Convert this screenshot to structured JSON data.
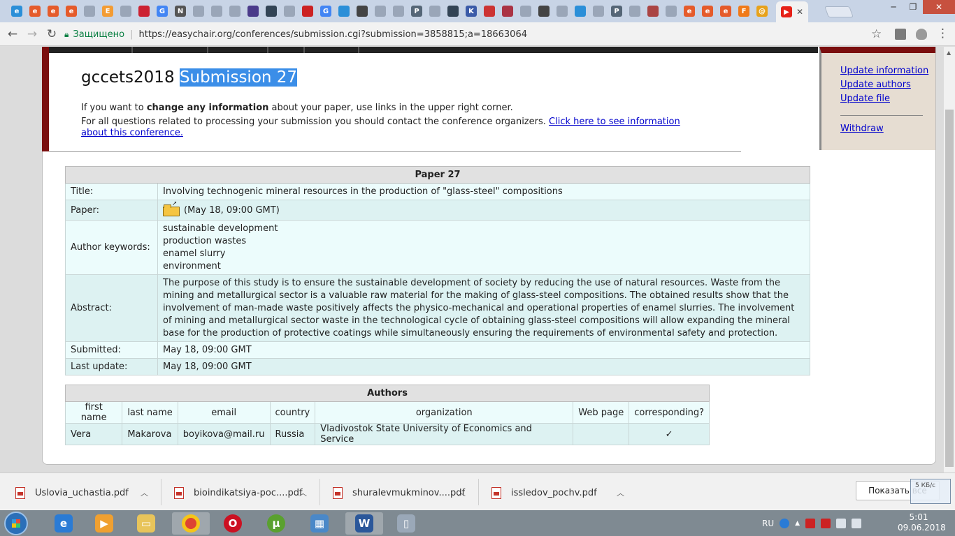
{
  "browser": {
    "tabs": [
      {
        "icon": "globe-icon",
        "color": "#2b8fd8",
        "glyph": "e"
      },
      {
        "icon": "e-orange-icon",
        "color": "#e55b2b",
        "glyph": "e"
      },
      {
        "icon": "e-orange-icon",
        "color": "#e55b2b",
        "glyph": "e"
      },
      {
        "icon": "e-orange-icon",
        "color": "#e55b2b",
        "glyph": "e"
      },
      {
        "icon": "doc-icon",
        "color": "#9aa6b8",
        "glyph": ""
      },
      {
        "icon": "e-box-icon",
        "color": "#f39c34",
        "glyph": "E"
      },
      {
        "icon": "doc-icon",
        "color": "#9aa6b8",
        "glyph": ""
      },
      {
        "icon": "news-icon",
        "color": "#cc2233",
        "glyph": ""
      },
      {
        "icon": "google-icon",
        "color": "#4285f4",
        "glyph": "G"
      },
      {
        "icon": "n-icon",
        "color": "#555555",
        "glyph": "N"
      },
      {
        "icon": "doc-icon",
        "color": "#9aa6b8",
        "glyph": ""
      },
      {
        "icon": "doc-icon",
        "color": "#9aa6b8",
        "glyph": ""
      },
      {
        "icon": "doc-icon",
        "color": "#9aa6b8",
        "glyph": ""
      },
      {
        "icon": "pattern-icon",
        "color": "#4a3a8a",
        "glyph": ""
      },
      {
        "icon": "swirl-icon",
        "color": "#334455",
        "glyph": ""
      },
      {
        "icon": "doc-icon",
        "color": "#9aa6b8",
        "glyph": ""
      },
      {
        "icon": "arrow-icon",
        "color": "#cc2222",
        "glyph": ""
      },
      {
        "icon": "google-icon",
        "color": "#4285f4",
        "glyph": "G"
      },
      {
        "icon": "globe-icon",
        "color": "#2b8fd8",
        "glyph": ""
      },
      {
        "icon": "puzzle-icon",
        "color": "#444444",
        "glyph": ""
      },
      {
        "icon": "doc-icon",
        "color": "#9aa6b8",
        "glyph": ""
      },
      {
        "icon": "doc-icon",
        "color": "#9aa6b8",
        "glyph": ""
      },
      {
        "icon": "rkp-icon",
        "color": "#556677",
        "glyph": "P"
      },
      {
        "icon": "doc-icon",
        "color": "#9aa6b8",
        "glyph": ""
      },
      {
        "icon": "swirl-icon",
        "color": "#334455",
        "glyph": ""
      },
      {
        "icon": "k-icon",
        "color": "#3b5ba8",
        "glyph": "K"
      },
      {
        "icon": "flag-icon",
        "color": "#cc3333",
        "glyph": ""
      },
      {
        "icon": "cube-icon",
        "color": "#aa3344",
        "glyph": ""
      },
      {
        "icon": "doc-icon",
        "color": "#9aa6b8",
        "glyph": ""
      },
      {
        "icon": "gear-icon",
        "color": "#444444",
        "glyph": ""
      },
      {
        "icon": "doc-icon",
        "color": "#9aa6b8",
        "glyph": ""
      },
      {
        "icon": "globe-icon",
        "color": "#2b8fd8",
        "glyph": ""
      },
      {
        "icon": "doc-icon",
        "color": "#9aa6b8",
        "glyph": ""
      },
      {
        "icon": "rkp-icon",
        "color": "#556677",
        "glyph": "P"
      },
      {
        "icon": "doc-icon",
        "color": "#9aa6b8",
        "glyph": ""
      },
      {
        "icon": "book-icon",
        "color": "#aa4444",
        "glyph": ""
      },
      {
        "icon": "doc-icon",
        "color": "#9aa6b8",
        "glyph": ""
      },
      {
        "icon": "e-orange-icon",
        "color": "#e55b2b",
        "glyph": "e"
      },
      {
        "icon": "e-orange-icon",
        "color": "#e55b2b",
        "glyph": "e"
      },
      {
        "icon": "e-orange-icon",
        "color": "#e55b2b",
        "glyph": "e"
      },
      {
        "icon": "f-icon",
        "color": "#f07a1a",
        "glyph": "F"
      },
      {
        "icon": "at-icon",
        "color": "#e8a21a",
        "glyph": "@"
      }
    ],
    "active_tab_icon": "youtube-icon",
    "secure_label": "Защищено",
    "url": "https://easychair.org/conferences/submission.cgi?submission=3858815;a=18663064"
  },
  "page": {
    "title_prefix": "gccets2018",
    "title_highlight": "Submission 27",
    "info_line1_before": "If you want to",
    "info_line1_bold": "change any information",
    "info_line1_after": "about your paper, use links in the upper right corner.",
    "info_line2": "For all questions related to processing your submission you should contact the conference organizers.",
    "info_link": "Click here to see information about this conference."
  },
  "right_menu": {
    "update_information": "Update information",
    "update_authors": "Update authors",
    "update_file": "Update file",
    "withdraw": "Withdraw"
  },
  "paper": {
    "header": "Paper 27",
    "title_label": "Title:",
    "title": "Involving technogenic mineral resources in the production of \"glass-steel\" compositions",
    "paper_label": "Paper:",
    "paper_date": "(May 18, 09:00 GMT)",
    "keywords_label": "Author keywords:",
    "keywords": [
      "sustainable development",
      "production wastes",
      "enamel slurry",
      "environment"
    ],
    "abstract_label": "Abstract:",
    "abstract": "The purpose of this study is to ensure the sustainable development of society by reducing the use of natural resources. Waste from the mining and metallurgical sector is a valuable raw material for the making of glass-steel compositions. The obtained results show that the involvement of man-made waste positively affects the physico-mechanical and operational properties of enamel slurries. The involvement of mining and metallurgical sector waste in the technological cycle of obtaining glass-steel compositions will allow expanding the mineral base for the production of protective coatings while simultaneously ensuring the requirements of environmental safety and protection.",
    "submitted_label": "Submitted:",
    "submitted": "May 18, 09:00 GMT",
    "updated_label": "Last update:",
    "updated": "May 18, 09:00 GMT"
  },
  "authors": {
    "header": "Authors",
    "columns": [
      "first name",
      "last name",
      "email",
      "country",
      "organization",
      "Web page",
      "corresponding?"
    ],
    "rows": [
      {
        "first": "Vera",
        "last": "Makarova",
        "email": "boyikova@mail.ru",
        "country": "Russia",
        "organization": "Vladivostok State University of Economics and Service",
        "web": "",
        "corresponding": "✓"
      }
    ]
  },
  "downloads": {
    "items": [
      "Uslovia_uchastia.pdf",
      "bioindikatsiya-poc....pdf",
      "shuralevmukminov....pdf",
      "issledov_pochv.pdf"
    ],
    "show_all": "Показать все",
    "speed": "5 КБ/с"
  },
  "taskbar": {
    "lang": "RU",
    "time": "5:01",
    "date": "09.06.2018"
  }
}
